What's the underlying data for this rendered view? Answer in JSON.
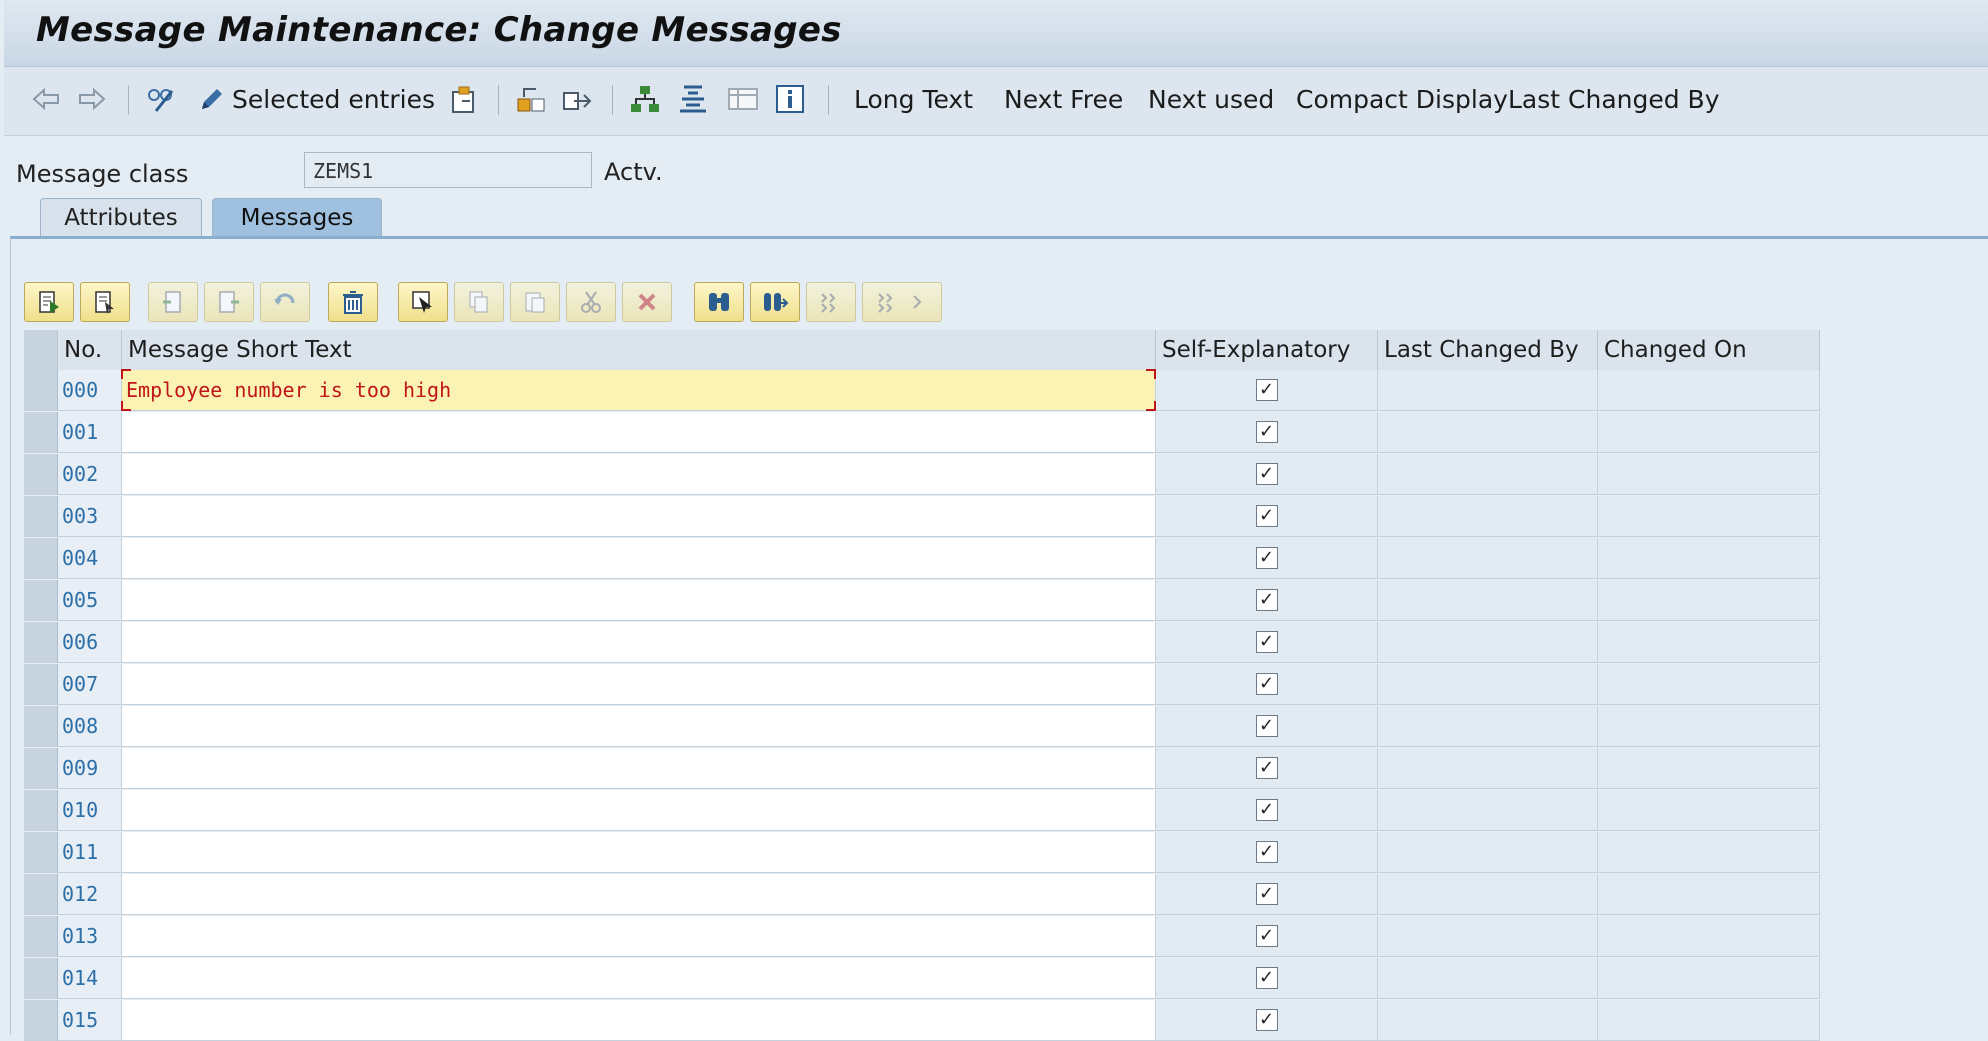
{
  "title": "Message Maintenance: Change Messages",
  "toolbar": {
    "selected_entries": "Selected entries",
    "long_text": "Long Text",
    "next_free": "Next Free",
    "next_used": "Next used",
    "compact_display": "Compact Display",
    "last_changed_by": "Last Changed By"
  },
  "fields": {
    "message_class_label": "Message class",
    "message_class_value": "ZEMS1",
    "status": "Actv."
  },
  "tabs": {
    "attributes": "Attributes",
    "messages": "Messages"
  },
  "table": {
    "columns": {
      "no": "No.",
      "short_text": "Message Short Text",
      "self_explanatory": "Self-Explanatory",
      "last_changed_by": "Last Changed By",
      "changed_on": "Changed On"
    },
    "rows": [
      {
        "no": "000",
        "text": "Employee number is too high",
        "self_explanatory": true
      },
      {
        "no": "001",
        "text": "",
        "self_explanatory": true
      },
      {
        "no": "002",
        "text": "",
        "self_explanatory": true
      },
      {
        "no": "003",
        "text": "",
        "self_explanatory": true
      },
      {
        "no": "004",
        "text": "",
        "self_explanatory": true
      },
      {
        "no": "005",
        "text": "",
        "self_explanatory": true
      },
      {
        "no": "006",
        "text": "",
        "self_explanatory": true
      },
      {
        "no": "007",
        "text": "",
        "self_explanatory": true
      },
      {
        "no": "008",
        "text": "",
        "self_explanatory": true
      },
      {
        "no": "009",
        "text": "",
        "self_explanatory": true
      },
      {
        "no": "010",
        "text": "",
        "self_explanatory": true
      },
      {
        "no": "011",
        "text": "",
        "self_explanatory": true
      },
      {
        "no": "012",
        "text": "",
        "self_explanatory": true
      },
      {
        "no": "013",
        "text": "",
        "self_explanatory": true
      },
      {
        "no": "014",
        "text": "",
        "self_explanatory": true
      },
      {
        "no": "015",
        "text": "",
        "self_explanatory": true
      }
    ]
  }
}
